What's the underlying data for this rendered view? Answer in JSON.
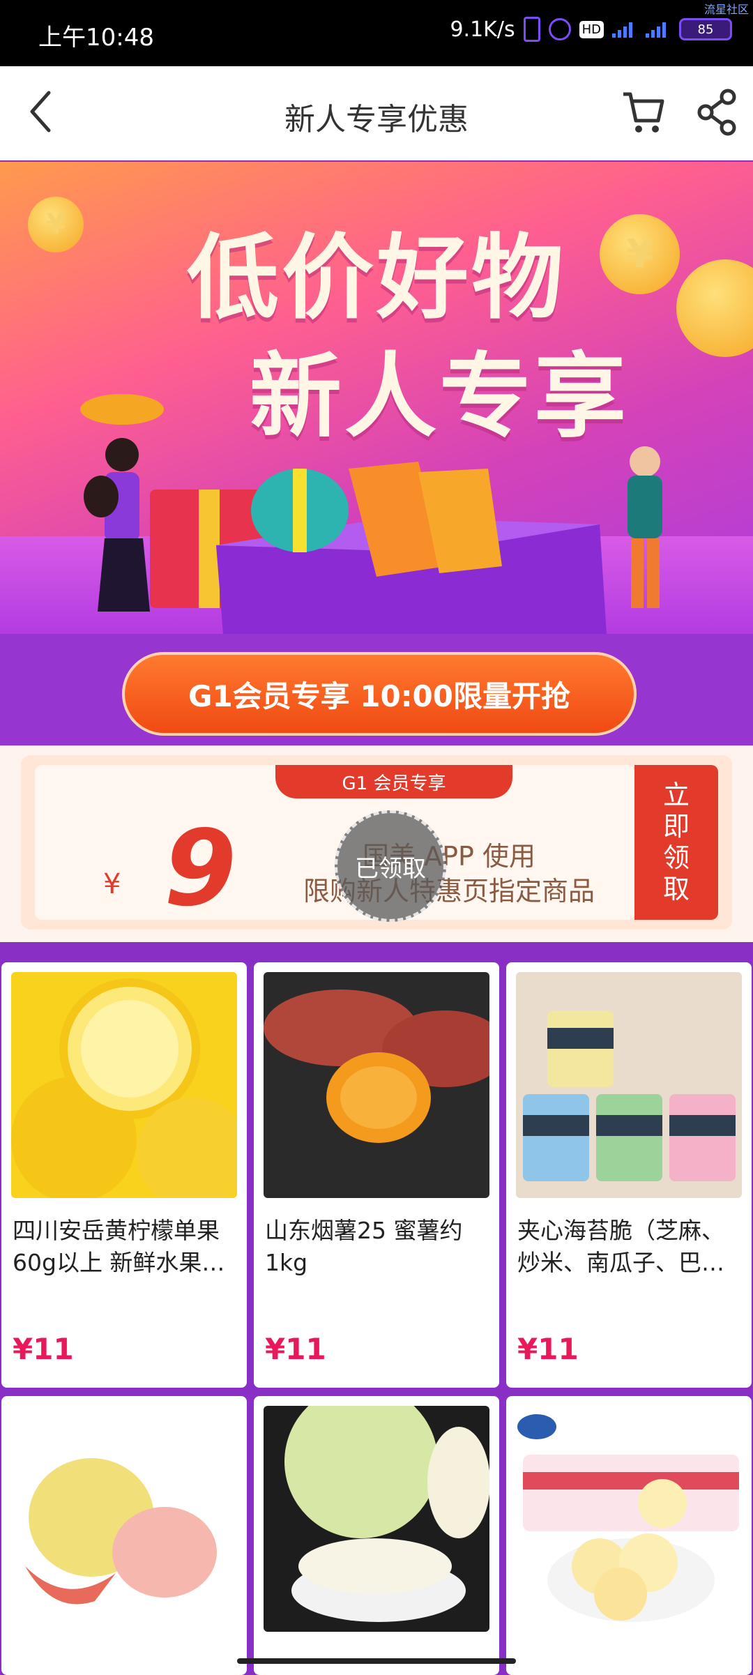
{
  "status_bar": {
    "time": "上午10:48",
    "net_speed": "9.1K/s",
    "hd": "HD",
    "battery": "85",
    "watermark": "流星社区"
  },
  "nav": {
    "title": "新人专享优惠",
    "back_icon": "back-arrow-icon",
    "cart_icon": "cart-icon",
    "share_icon": "share-icon"
  },
  "banner": {
    "line1": "低价好物",
    "line2": "新人专享",
    "coin_symbol": "¥"
  },
  "grab_button": {
    "label": "G1会员专享 10:00限量开抢"
  },
  "coupon": {
    "tag": "G1 会员专享",
    "currency": "¥",
    "amount": "9",
    "desc1": "国美 APP 使用",
    "desc2": "限购新人特惠页指定商品",
    "stamp": "已领取",
    "claim_label": "立即领取"
  },
  "products": [
    {
      "name": "四川安岳黄柠檬单果60g以上 新鲜水果…",
      "price": "¥11",
      "image": "lemon"
    },
    {
      "name": "山东烟薯25 蜜薯约1kg",
      "price": "¥11",
      "image": "sweet-potato"
    },
    {
      "name": "夹心海苔脆（芝麻、炒米、南瓜子、巴…",
      "price": "¥11",
      "image": "seaweed"
    },
    {
      "name": "",
      "price": "",
      "image": "pomelo-red"
    },
    {
      "name": "",
      "price": "",
      "image": "pomelo-white"
    },
    {
      "name": "",
      "price": "",
      "image": "kong-bread"
    }
  ],
  "colors": {
    "accent_red": "#e23a2b",
    "price_pink": "#e8185a",
    "page_purple": "#8a2fc5",
    "grab_orange": "#f04a12"
  }
}
